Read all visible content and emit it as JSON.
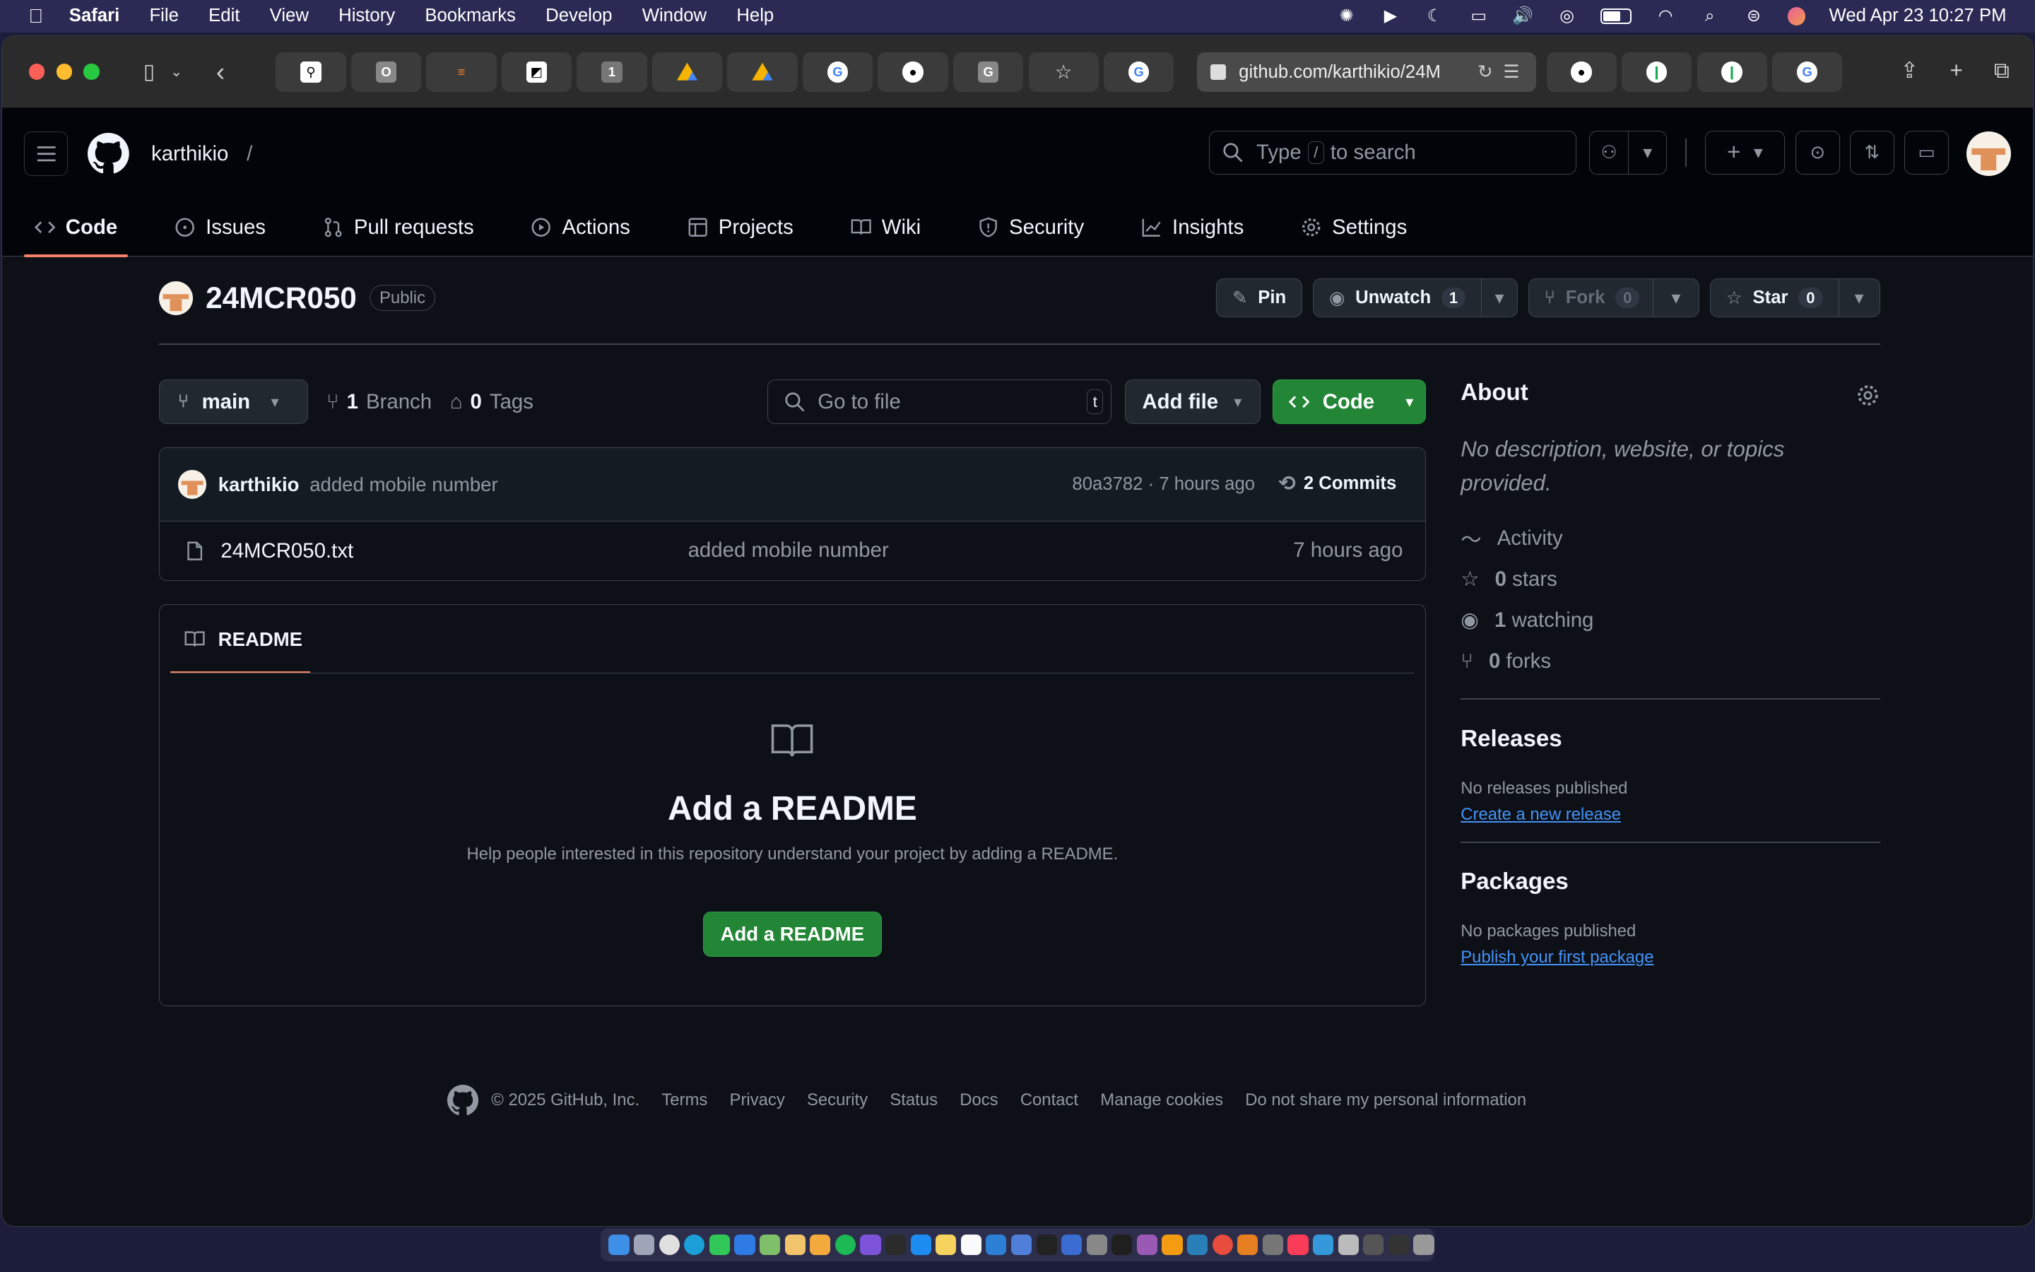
{
  "menubar": {
    "app": "Safari",
    "items": [
      "File",
      "Edit",
      "View",
      "History",
      "Bookmarks",
      "Develop",
      "Window",
      "Help"
    ],
    "datetime": "Wed Apr 23  10:27 PM"
  },
  "browser": {
    "url": "github.com/karthikio/24M",
    "tab_icons_left": [
      "link-icon",
      "o-icon",
      "stack-icon",
      "sidekick-icon",
      "1-icon",
      "drive-icon",
      "drive-icon",
      "google-icon",
      "github-icon",
      "g-icon",
      "star-icon",
      "google-icon"
    ],
    "tab_icons_right": [
      "github-icon",
      "mongo-icon",
      "mongo-icon",
      "google-icon"
    ]
  },
  "header": {
    "owner": "karthikio",
    "separator": "/",
    "repo": "24MCR050",
    "search_type": "Type",
    "search_key": "/",
    "search_rest": "to search"
  },
  "nav": {
    "code": "Code",
    "issues": "Issues",
    "pulls": "Pull requests",
    "actions": "Actions",
    "projects": "Projects",
    "wiki": "Wiki",
    "security": "Security",
    "insights": "Insights",
    "settings": "Settings"
  },
  "repo": {
    "name": "24MCR050",
    "visibility": "Public",
    "pin": "Pin",
    "unwatch": "Unwatch",
    "watch_count": "1",
    "fork": "Fork",
    "fork_count": "0",
    "star": "Star",
    "star_count": "0"
  },
  "toolbar": {
    "branch": "main",
    "branches_count": "1",
    "branches_label": "Branch",
    "tags_count": "0",
    "tags_label": "Tags",
    "go_to_file": "Go to file",
    "go_to_file_key": "t",
    "add_file": "Add file",
    "code": "Code"
  },
  "commit": {
    "author": "karthikio",
    "message": "added mobile number",
    "meta": "80a3782 · 7 hours ago",
    "commits": "2 Commits"
  },
  "files": [
    {
      "name": "24MCR050.txt",
      "message": "added mobile number",
      "time": "7 hours ago"
    }
  ],
  "readme": {
    "tab": "README",
    "title": "Add a README",
    "subtitle": "Help people interested in this repository understand your project by adding a README.",
    "button": "Add a README"
  },
  "about": {
    "title": "About",
    "description": "No description, website, or topics provided.",
    "activity": "Activity",
    "stars_count": "0",
    "stars_label": "stars",
    "watching_count": "1",
    "watching_label": "watching",
    "forks_count": "0",
    "forks_label": "forks"
  },
  "releases": {
    "title": "Releases",
    "empty": "No releases published",
    "link": "Create a new release"
  },
  "packages": {
    "title": "Packages",
    "empty": "No packages published",
    "link": "Publish your first package"
  },
  "footer": {
    "copyright": "© 2025 GitHub, Inc.",
    "links": [
      "Terms",
      "Privacy",
      "Security",
      "Status",
      "Docs",
      "Contact",
      "Manage cookies",
      "Do not share my personal information"
    ]
  },
  "colors": {
    "accent_green": "#238636",
    "link_blue": "#4493f8",
    "tab_underline": "#f78166",
    "background": "#0d1117"
  }
}
